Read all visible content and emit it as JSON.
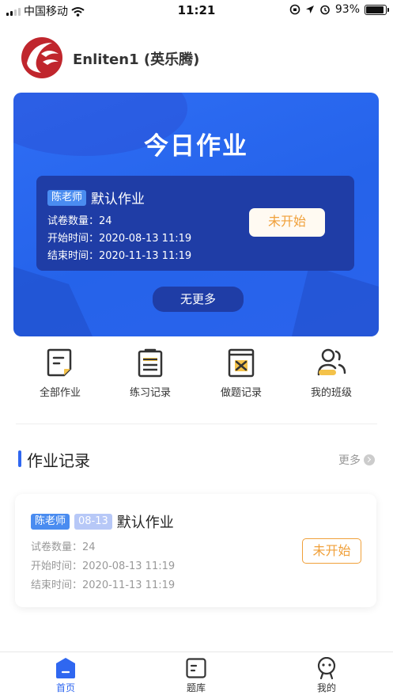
{
  "status_bar": {
    "carrier": "中国移动",
    "time": "11:21",
    "battery": "93%"
  },
  "header": {
    "title": "Enliten1 (英乐腾)"
  },
  "banner": {
    "title": "今日作业",
    "card": {
      "teacher": "陈老师",
      "name": "默认作业",
      "count_line": "试卷数量：24",
      "start_line": "开始时间：2020-08-13 11:19",
      "end_line": "结束时间：2020-11-13 11:19",
      "status": "未开始"
    },
    "no_more": "无更多"
  },
  "menu": {
    "items": [
      {
        "label": "全部作业",
        "icon": "document-icon"
      },
      {
        "label": "练习记录",
        "icon": "clipboard-icon"
      },
      {
        "label": "做题记录",
        "icon": "book-x-icon"
      },
      {
        "label": "我的班级",
        "icon": "people-icon"
      }
    ]
  },
  "section": {
    "title": "作业记录",
    "more": "更多"
  },
  "record": {
    "teacher": "陈老师",
    "date": "08-13",
    "name": "默认作业",
    "count_line": "试卷数量：24",
    "start_line": "开始时间：2020-08-13 11:19",
    "end_line": "结束时间：2020-11-13 11:19",
    "status": "未开始"
  },
  "tabbar": {
    "items": [
      {
        "label": "首页",
        "icon": "home-icon"
      },
      {
        "label": "题库",
        "icon": "question-bank-icon"
      },
      {
        "label": "我的",
        "icon": "profile-icon"
      }
    ]
  },
  "colors": {
    "accent": "#2f67f0",
    "banner": "#2563ea",
    "status_orange": "#f0a03a"
  }
}
